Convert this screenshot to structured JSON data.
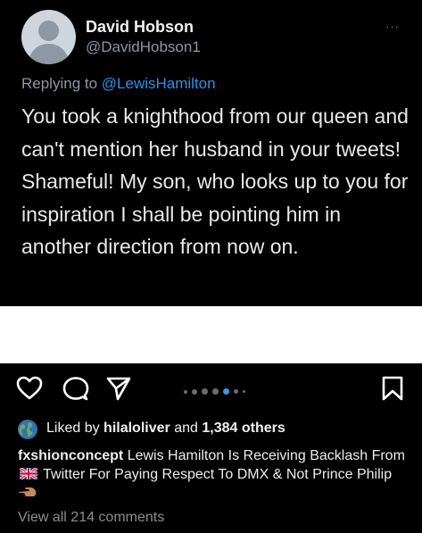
{
  "tweet": {
    "display_name": "David Hobson",
    "handle": "@DavidHobson1",
    "more_label": "···",
    "reply_prefix": "Replying to",
    "reply_mention": "@LewisHamilton",
    "text": "You took a knighthood from our queen and can't mention her husband in your tweets! Shameful! My son, who looks up to you for inspiration I shall be pointing him in another direction from now on."
  },
  "post": {
    "liked_prefix": "Liked by",
    "liked_user": "hilaloliver",
    "liked_joiner": "and",
    "liked_count": "1,384 others",
    "caption_user": "fxshionconcept",
    "caption_part1": "Lewis Hamilton Is Receiving Backlash From",
    "caption_part2": "Twitter For Paying Respect To DMX & Not Prince Philip",
    "view_all": "View all 214 comments",
    "carousel": {
      "total": 7,
      "active_index": 4
    }
  },
  "colors": {
    "background": "#000000",
    "separator": "#ffffff",
    "mention": "#2f91e6",
    "secondary_text": "#8b98a5",
    "muted": "#8e8e8e"
  },
  "icons": [
    "heart-icon",
    "comment-icon",
    "share-icon",
    "bookmark-icon",
    "globe-icon",
    "uk-flag-icon",
    "pointing-hand-icon"
  ]
}
